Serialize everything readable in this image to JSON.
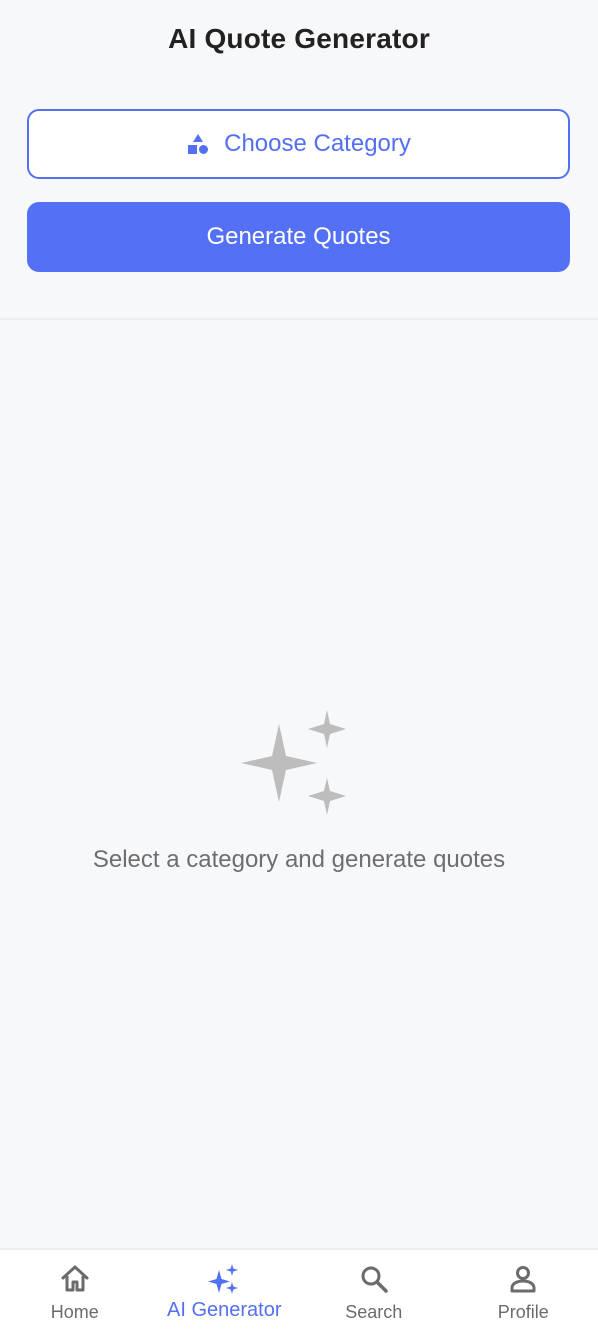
{
  "header": {
    "title": "AI Quote Generator"
  },
  "controls": {
    "choose_category_label": "Choose Category",
    "generate_label": "Generate Quotes"
  },
  "empty_state": {
    "icon": "sparkles-icon",
    "message": "Select a category and generate quotes"
  },
  "bottom_nav": {
    "items": [
      {
        "label": "Home",
        "icon": "home-icon",
        "active": false
      },
      {
        "label": "AI Generator",
        "icon": "sparkles-icon",
        "active": true
      },
      {
        "label": "Search",
        "icon": "search-icon",
        "active": false
      },
      {
        "label": "Profile",
        "icon": "person-icon",
        "active": false
      }
    ]
  },
  "colors": {
    "accent": "#5470f2",
    "background": "#f7f8fa",
    "muted_icon": "#bdbdbd",
    "inactive_text": "#6b6b6b"
  }
}
